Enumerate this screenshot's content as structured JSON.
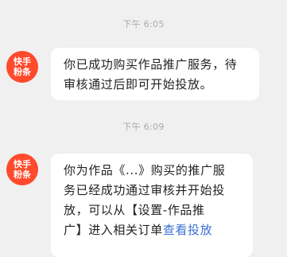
{
  "messages": [
    {
      "time": "下午 6:05",
      "avatar_line1": "快手",
      "avatar_line2": "粉条",
      "lines": [
        "你已成功购买作品推广服务，待",
        "审核通过后即可开始投放。"
      ]
    },
    {
      "time": "下午 6:09",
      "avatar_line1": "快手",
      "avatar_line2": "粉条",
      "lines": [
        "你为作品《...》购买的推广服",
        "务已经成功通过审核并开始投",
        "放，可以从【设置-作品推"
      ],
      "last_line_prefix": "广】进入相关订单",
      "last_line_link": "查看投放"
    }
  ]
}
